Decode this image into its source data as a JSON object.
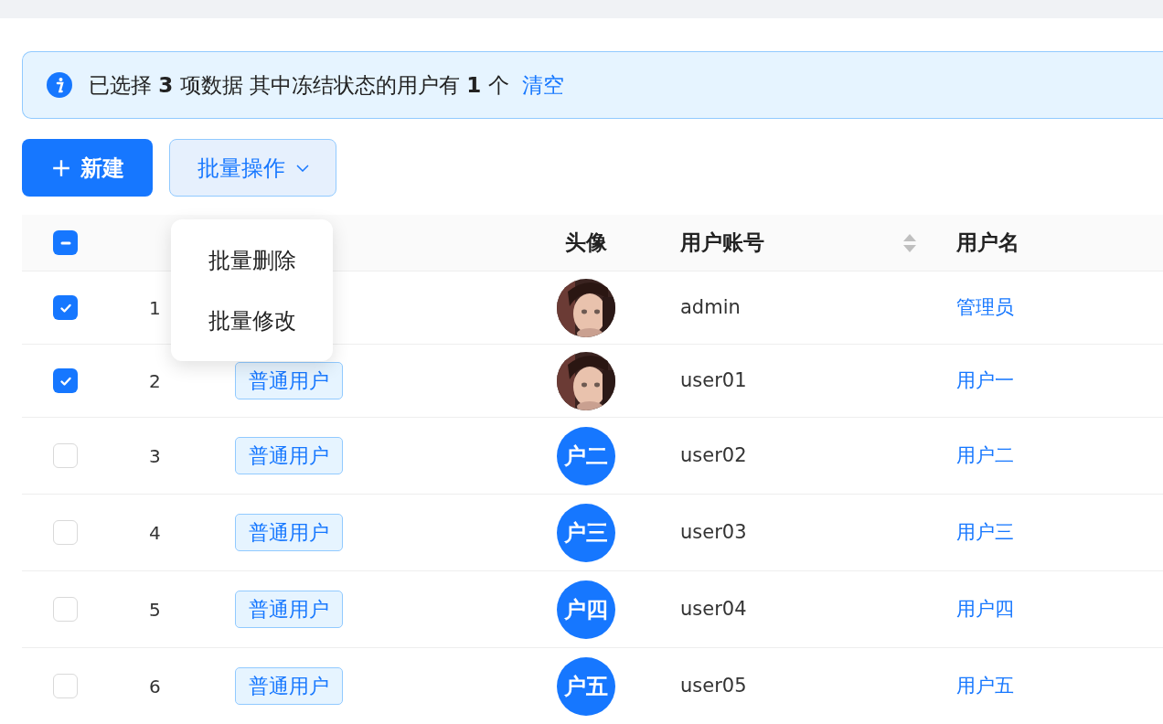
{
  "alert": {
    "text": "已选择 **3** 项数据 其中冻结状态的用户有 **1** 个",
    "action": "清空"
  },
  "toolbar": {
    "new_button": "新建",
    "batch_button": "批量操作",
    "batch_menu": {
      "expanded": true,
      "items": [
        "批量删除",
        "批量修改"
      ]
    }
  },
  "table": {
    "header_checkbox": {
      "indeterminate": true
    },
    "columns": [
      {
        "label": "头像",
        "sortable": false
      },
      {
        "label": "用户账号",
        "sortable": true
      },
      {
        "label": "用户名",
        "sortable": false
      }
    ],
    "rows": [
      {
        "checked": true,
        "index": "1",
        "account": "admin",
        "username": "管理员"
      },
      {
        "checked": true,
        "index": "2",
        "role": "普通用户",
        "account": "user01",
        "username": "用户一"
      },
      {
        "checked": false,
        "index": "3",
        "role": "普通用户",
        "account": "user02",
        "username": "用户二",
        "avatar": {
          "kind": "text",
          "text": "户二"
        }
      },
      {
        "checked": false,
        "index": "4",
        "role": "普通用户",
        "account": "user03",
        "username": "用户三",
        "avatar": {
          "kind": "text",
          "text": "户三"
        }
      },
      {
        "checked": false,
        "index": "5",
        "role": "普通用户",
        "account": "user04",
        "username": "用户四",
        "avatar": {
          "kind": "text",
          "text": "户四"
        }
      },
      {
        "checked": false,
        "index": "6",
        "role": "普通用户",
        "account": "user05",
        "username": "用户五",
        "avatar": {
          "kind": "text",
          "text": "户五"
        }
      }
    ]
  }
}
